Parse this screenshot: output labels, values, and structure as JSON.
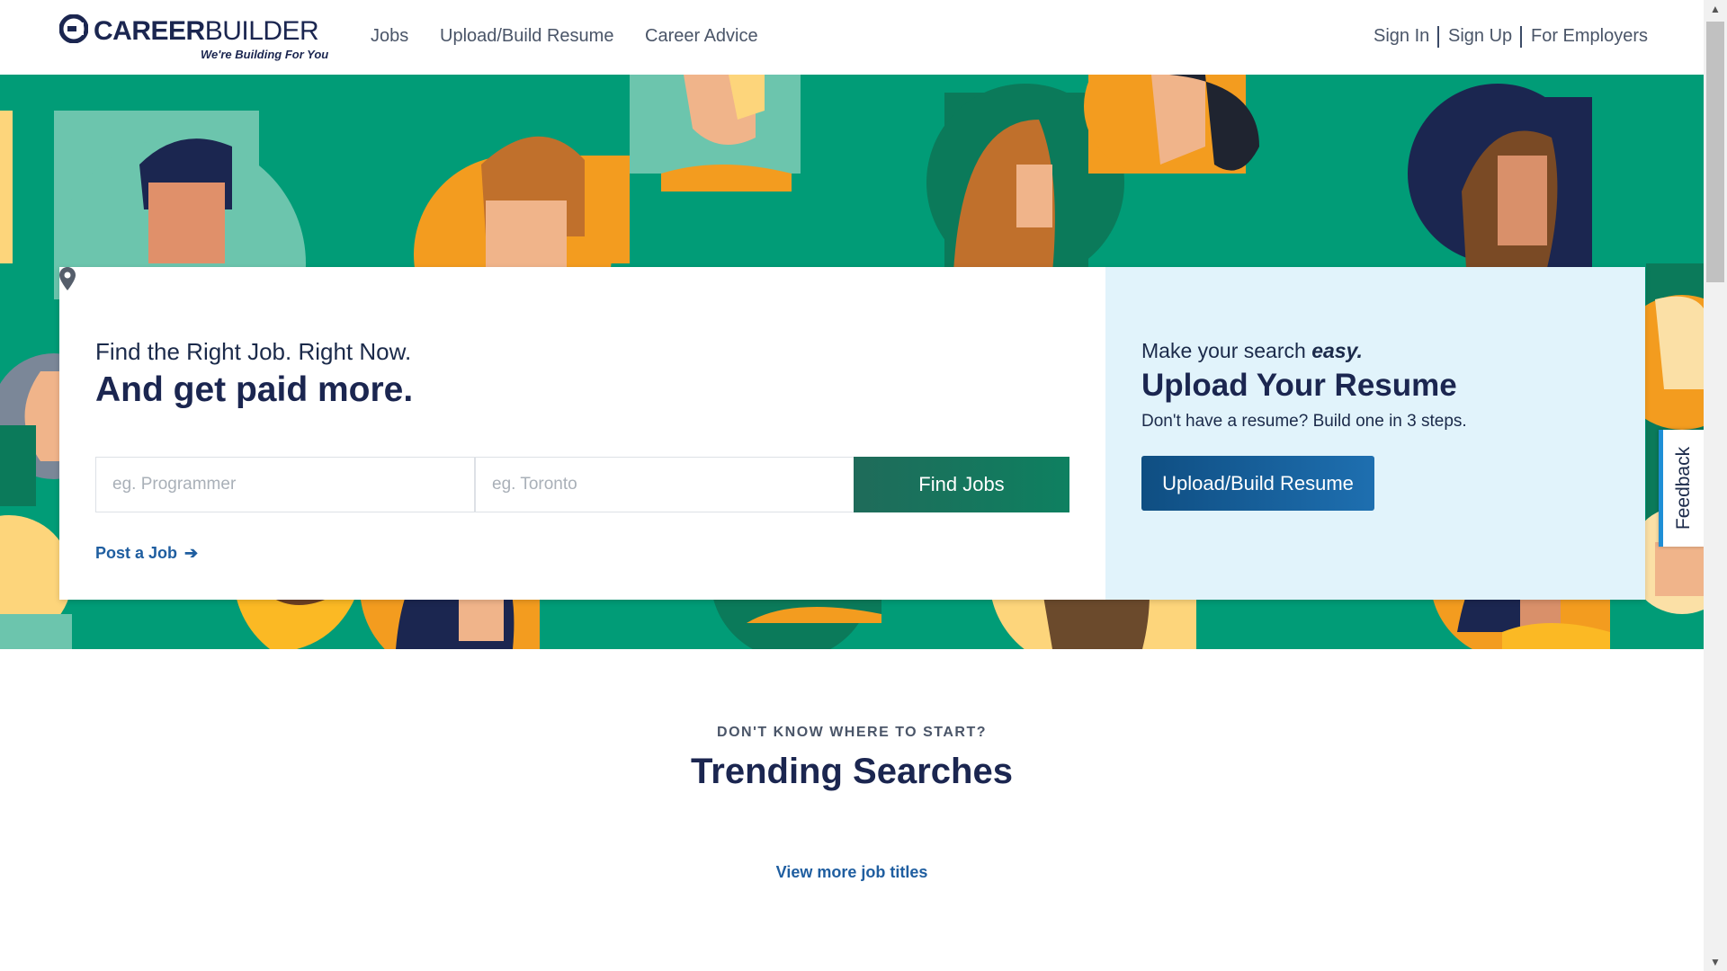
{
  "header": {
    "logo_text_bold": "CAREER",
    "logo_text_thin": "BUILDER",
    "logo_tagline": "We're Building For You",
    "nav": [
      "Jobs",
      "Upload/Build Resume",
      "Career Advice"
    ],
    "auth": [
      "Sign In",
      "Sign Up",
      "For Employers"
    ]
  },
  "search": {
    "tagline": "Find the Right Job. Right Now.",
    "headline": "And get paid more.",
    "keyword_placeholder": "eg. Programmer",
    "location_placeholder": "eg. Toronto",
    "find_button": "Find Jobs",
    "post_job": "Post a Job"
  },
  "resume": {
    "lead_plain": "Make your search ",
    "lead_em": "easy.",
    "title": "Upload Your Resume",
    "subtitle": "Don't have a resume? Build one in 3 steps.",
    "button": "Upload/Build Resume"
  },
  "feedback": "Feedback",
  "trending": {
    "eyebrow": "DON'T KNOW WHERE TO START?",
    "title": "Trending Searches",
    "view_more": "View more job titles"
  },
  "icons": {
    "logo": "careerbuilder-logo-icon",
    "location": "map-pin-icon",
    "arrow": "arrow-right-icon"
  },
  "colors": {
    "hero_green": "#019c77",
    "navy": "#1b2650",
    "link_blue": "#1f5ea0",
    "resume_panel": "#e1f3fb"
  }
}
